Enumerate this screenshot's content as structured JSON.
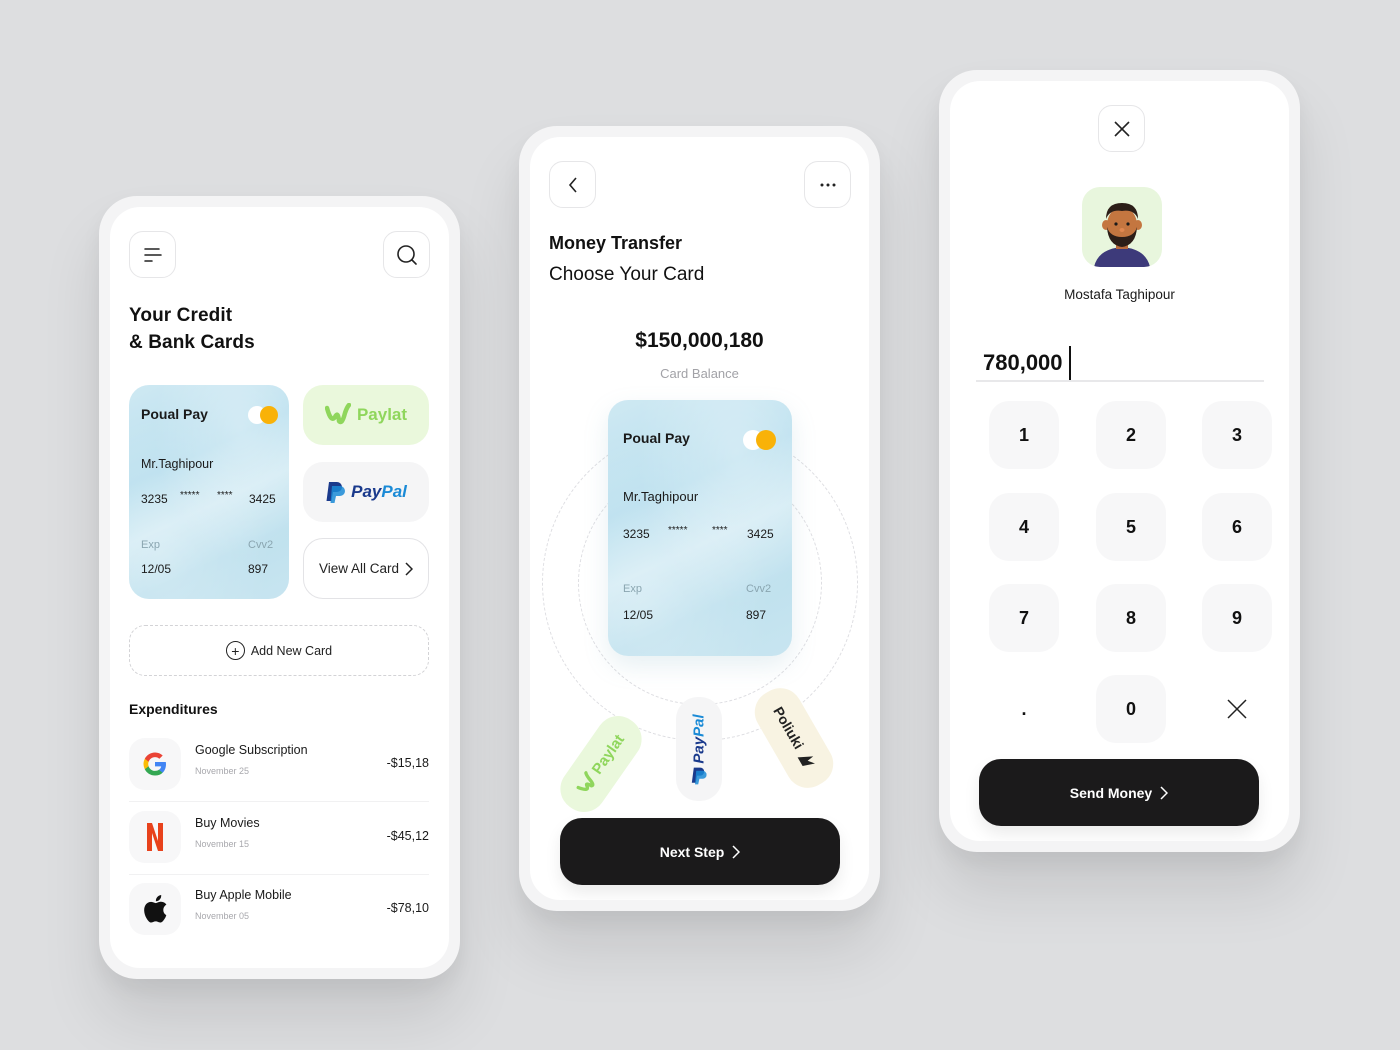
{
  "colors": {
    "background": "#dddee0",
    "accent_dark": "#1b1a1b",
    "card_blue": "#c3e3ef",
    "toggle_yellow": "#f9b208",
    "paylat_green": "#8fd65c",
    "paylat_bg": "#eaf8dc",
    "paypal_navy": "#1a3a8c",
    "paypal_blue": "#1a8ad6",
    "poliuki_bg": "#f8f3e2"
  },
  "screen1": {
    "menu_icon": "menu-icon",
    "search_icon": "search-icon",
    "title_line1": "Your Credit",
    "title_line2": "& Bank Cards",
    "card": {
      "brand": "Poual Pay",
      "holder": "Mr.Taghipour",
      "number_parts": [
        "3235",
        "*****",
        "****",
        "3425"
      ],
      "exp_label": "Exp",
      "exp_value": "12/05",
      "cvv_label": "Cvv2",
      "cvv_value": "897"
    },
    "wallets": [
      {
        "name": "Paylat",
        "icon": "paylat-logo-icon"
      },
      {
        "name_part1": "Pay",
        "name_part2": "Pal",
        "icon": "paypal-logo-icon"
      }
    ],
    "view_all_label": "View All Card",
    "add_card_label": "Add New Card",
    "expenditures_title": "Expenditures",
    "expenditures": [
      {
        "name": "Google Subscription",
        "date": "November 25",
        "amount": "-$15,18",
        "icon": "google-icon"
      },
      {
        "name": "Buy Movies",
        "date": "November 15",
        "amount": "-$45,12",
        "icon": "netflix-icon"
      },
      {
        "name": "Buy Apple Mobile",
        "date": "November 05",
        "amount": "-$78,10",
        "icon": "apple-icon"
      }
    ]
  },
  "screen2": {
    "back_icon": "chevron-left-icon",
    "more_icon": "more-horizontal-icon",
    "title": "Money Transfer",
    "subtitle": "Choose Your Card",
    "balance": "$150,000,180",
    "balance_label": "Card Balance",
    "card": {
      "brand": "Poual Pay",
      "holder": "Mr.Taghipour",
      "number_parts": [
        "3235",
        "*****",
        "****",
        "3425"
      ],
      "exp_label": "Exp",
      "exp_value": "12/05",
      "cvv_label": "Cvv2",
      "cvv_value": "897"
    },
    "payment_options": [
      {
        "name": "Paylat"
      },
      {
        "name_part1": "Pay",
        "name_part2": "Pal"
      },
      {
        "name": "Poliuki"
      }
    ],
    "next_label": "Next Step"
  },
  "screen3": {
    "close_icon": "close-icon",
    "recipient_name": "Mostafa Taghipour",
    "amount": "780,000",
    "keypad": [
      "1",
      "2",
      "3",
      "4",
      "5",
      "6",
      "7",
      "8",
      "9",
      ".",
      "0",
      "backspace"
    ],
    "send_label": "Send Money"
  }
}
